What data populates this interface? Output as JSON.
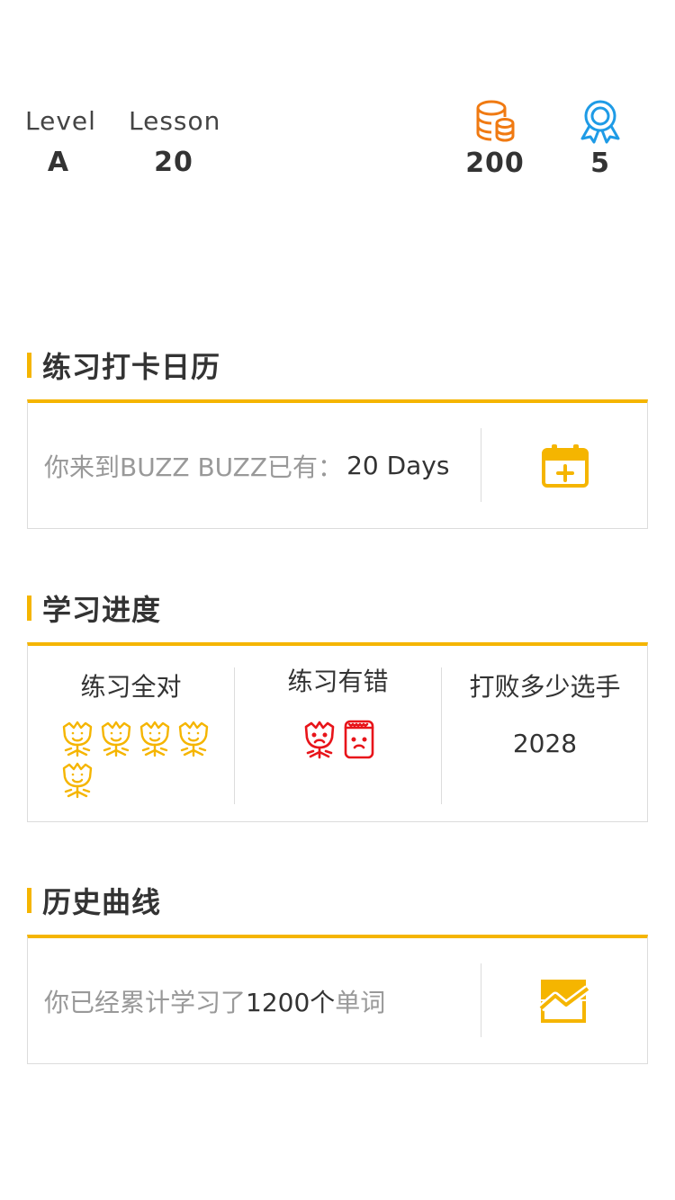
{
  "stats": {
    "level_label": "Level",
    "level_value": "A",
    "lesson_label": "Lesson",
    "lesson_value": "20",
    "coins_value": "200",
    "badges_value": "5",
    "coins_icon": "coins-icon",
    "badge_icon": "award-ribbon-icon",
    "coins_color": "#f07a12",
    "badge_color": "#1e9be6"
  },
  "calendar": {
    "title": "练习打卡日历",
    "text": "你来到BUZZ BUZZ已有：",
    "days": "20 Days",
    "action_icon": "calendar-add-icon"
  },
  "progress": {
    "title": "学习进度",
    "all_right_label": "练习全对",
    "all_right_count": 5,
    "all_right_icon": "happy-flower-icon",
    "mistakes_label": "练习有错",
    "mistakes_icons": [
      "sad-flower-icon",
      "sad-jar-icon"
    ],
    "beat_label": "打败多少选手",
    "beat_value": "2028"
  },
  "history": {
    "title": "历史曲线",
    "text": "你已经累计学习了",
    "count": "1200个",
    "suffix": "单词",
    "action_icon": "line-chart-icon"
  },
  "colors": {
    "accent": "#f5b500",
    "error": "#e8141a",
    "muted_text": "#999999",
    "text": "#333333"
  }
}
